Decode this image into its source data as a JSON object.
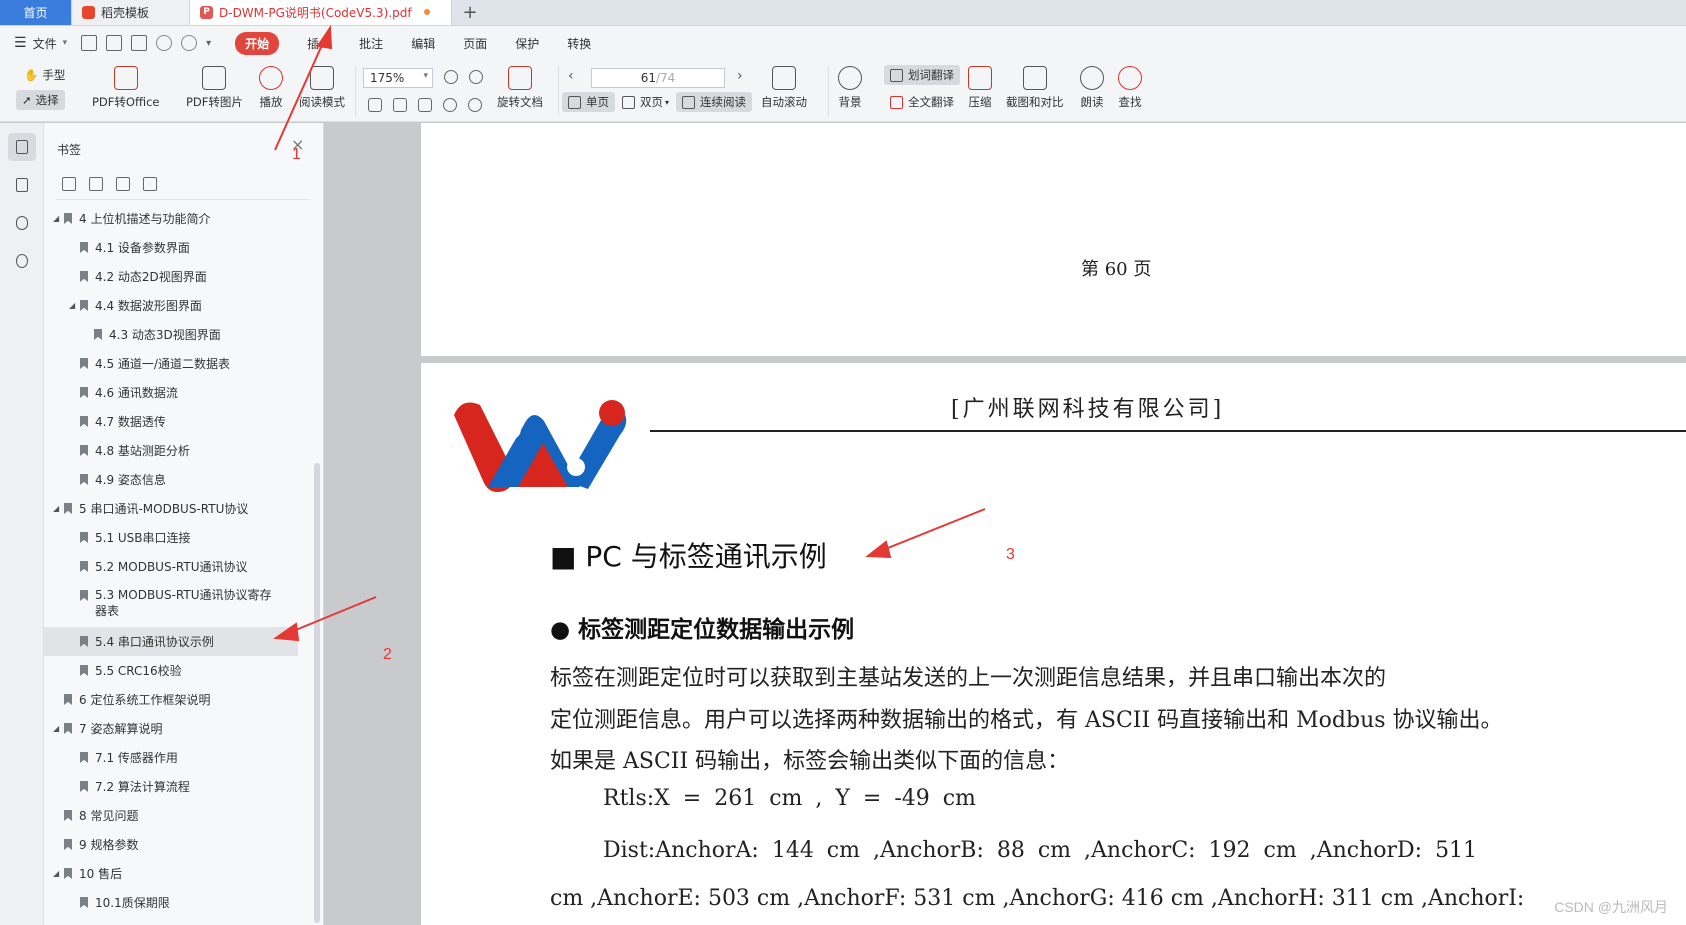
{
  "tabs": {
    "home": "首页",
    "template": "稻壳模板",
    "document": "D-DWM-PG说明书(CodeV5.3).pdf",
    "add": "+"
  },
  "menu": {
    "file": "文件",
    "items": [
      "开始",
      "插入",
      "批注",
      "编辑",
      "页面",
      "保护",
      "转换"
    ]
  },
  "ribbon": {
    "hand": "手型",
    "select": "选择",
    "pdf_to_office": "PDF转Office",
    "pdf_to_image": "PDF转图片",
    "play": "播放",
    "read_mode": "阅读模式",
    "zoom": "175%",
    "rotate": "旋转文档",
    "page_current": "61",
    "page_total": "/74",
    "single": "单页",
    "double": "双页",
    "continuous": "连续阅读",
    "auto_scroll": "自动滚动",
    "background": "背景",
    "word_translate": "划词翻译",
    "full_translate": "全文翻译",
    "compress": "压缩",
    "screenshot_compare": "截图和对比",
    "read_aloud": "朗读",
    "find": "查找"
  },
  "panel": {
    "title": "书签",
    "items": [
      {
        "label": "4 上位机描述与功能简介",
        "level": 0,
        "caret": true
      },
      {
        "label": "4.1 设备参数界面",
        "level": 1
      },
      {
        "label": "4.2 动态2D视图界面",
        "level": 1
      },
      {
        "label": "4.4 数据波形图界面",
        "level": 1,
        "caret": true
      },
      {
        "label": "4.3 动态3D视图界面",
        "level": 2
      },
      {
        "label": "4.5 通道一/通道二数据表",
        "level": 1
      },
      {
        "label": "4.6 通讯数据流",
        "level": 1
      },
      {
        "label": "4.7 数据透传",
        "level": 1
      },
      {
        "label": "4.8 基站测距分析",
        "level": 1
      },
      {
        "label": "4.9 姿态信息",
        "level": 1
      },
      {
        "label": "5 串口通讯-MODBUS-RTU协议",
        "level": 0,
        "caret": true
      },
      {
        "label": "5.1 USB串口连接",
        "level": 1
      },
      {
        "label": "5.2 MODBUS-RTU通讯协议",
        "level": 1
      },
      {
        "label": "5.3 MODBUS-RTU通讯协议寄存器表",
        "level": 1,
        "tall": true
      },
      {
        "label": "5.4 串口通讯协议示例",
        "level": 1,
        "active": true
      },
      {
        "label": "5.5 CRC16校验",
        "level": 1
      },
      {
        "label": "6 定位系统工作框架说明",
        "level": 0
      },
      {
        "label": "7 姿态解算说明",
        "level": 0,
        "caret": true
      },
      {
        "label": "7.1 传感器作用",
        "level": 1
      },
      {
        "label": "7.2 算法计算流程",
        "level": 1
      },
      {
        "label": "8 常见问题",
        "level": 0
      },
      {
        "label": "9 规格参数",
        "level": 0
      },
      {
        "label": "10 售后",
        "level": 0,
        "caret": true
      },
      {
        "label": "10.1质保期限",
        "level": 1
      }
    ]
  },
  "document": {
    "prev_page_footer": "第 60 页",
    "company": "[广州联网科技有限公司]",
    "heading1": "■ PC 与标签通讯示例",
    "heading2": "●  标签测距定位数据输出示例",
    "para1": "    标签在测距定位时可以获取到主基站发送的上一次测距信息结果，并且串口输出本次的",
    "para2": "定位测距信息。用户可以选择两种数据输出的格式，有 ASCII 码直接输出和 Modbus 协议输出。",
    "para3": "如果是 ASCII 码输出，标签会输出类似下面的信息：",
    "code1": "Rtls:X = 261 cm , Y = -49 cm",
    "code2": "Dist:AnchorA:  144  cm  ,AnchorB:  88  cm  ,AnchorC:  192  cm  ,AnchorD:  511",
    "code3": "cm ,AnchorE: 503 cm ,AnchorF: 531 cm ,AnchorG: 416 cm ,AnchorH: 311 cm ,AnchorI:"
  },
  "annotations": {
    "n1": "1",
    "n2": "2",
    "n3": "3"
  },
  "watermark": "CSDN @九洲风月",
  "colors": {
    "accent": "#e0463d",
    "home_tab": "#3b7ddd",
    "annotation": "#e53935"
  }
}
